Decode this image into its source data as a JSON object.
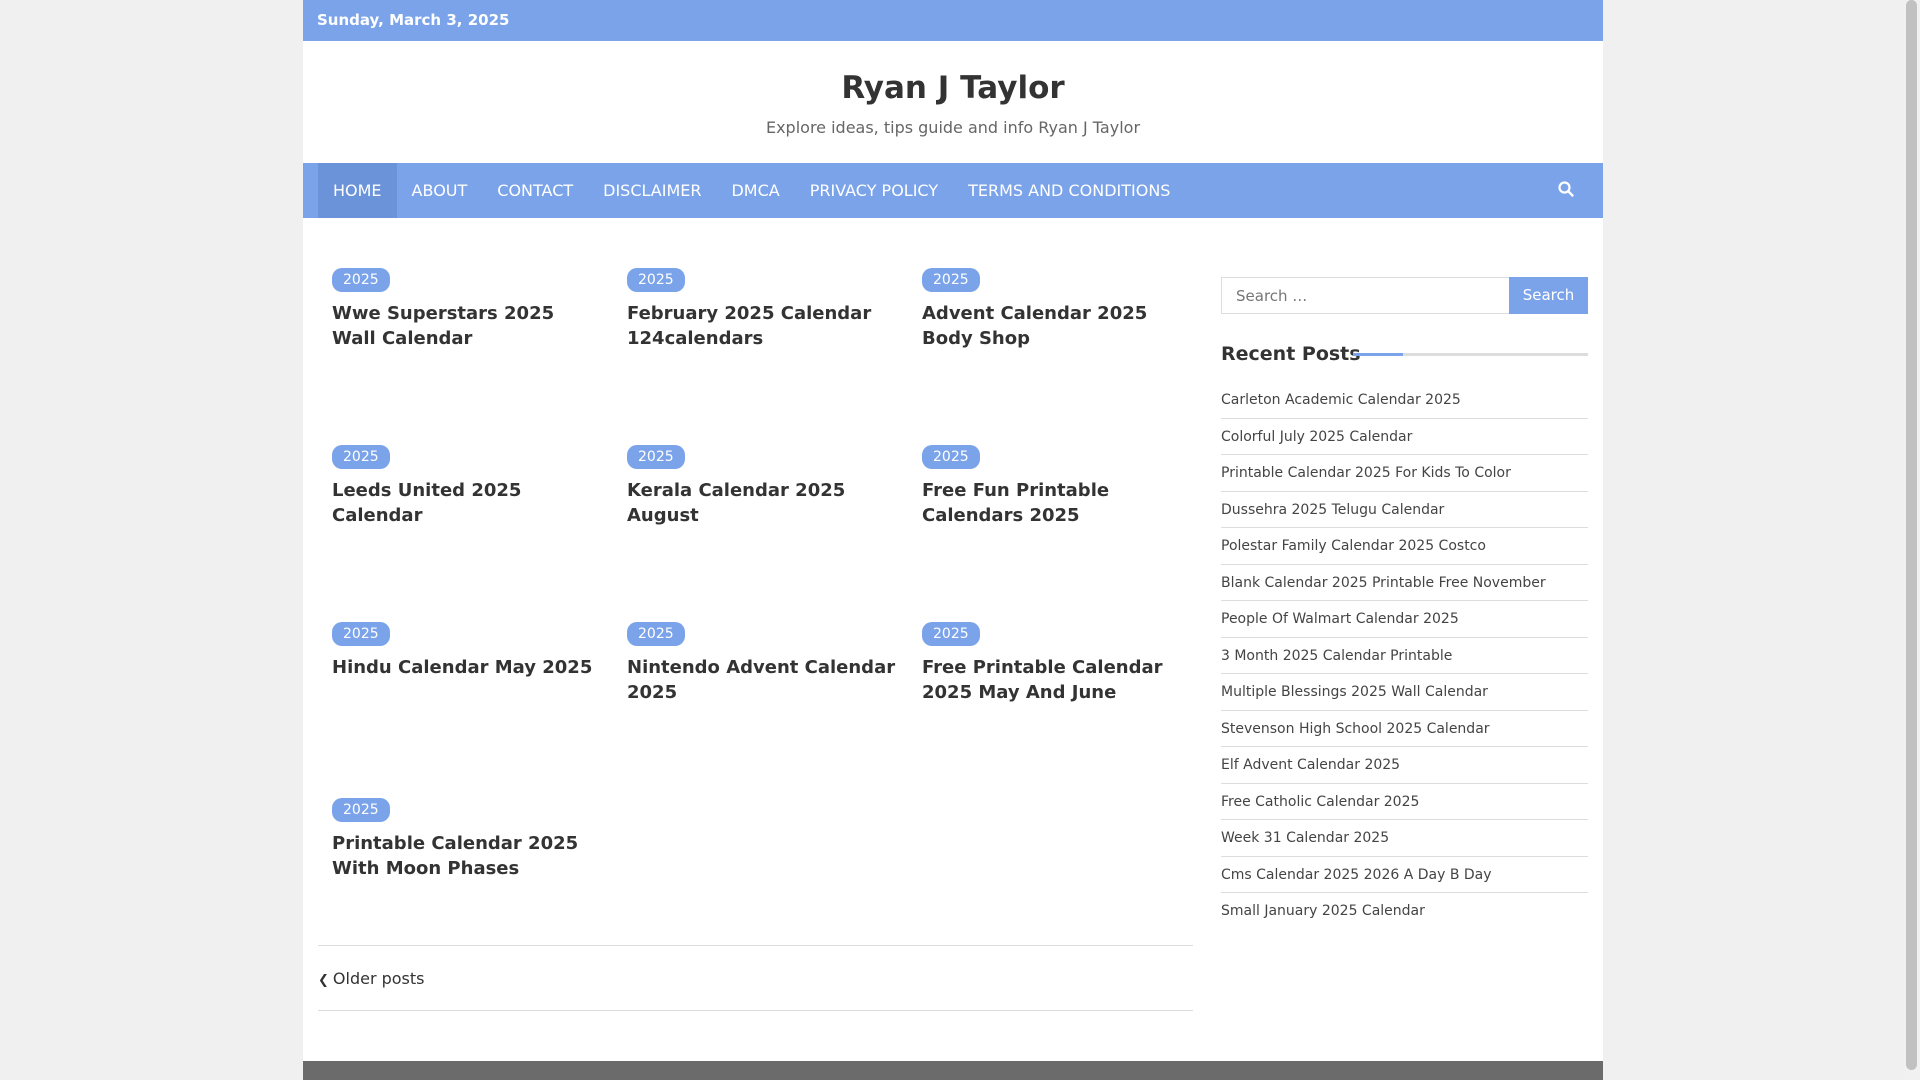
{
  "topbar": {
    "date": "Sunday, March 3, 2025"
  },
  "site": {
    "title": "Ryan J Taylor",
    "description": "Explore ideas, tips guide and info Ryan J Taylor"
  },
  "nav": {
    "items": [
      {
        "label": "HOME"
      },
      {
        "label": "ABOUT"
      },
      {
        "label": "CONTACT"
      },
      {
        "label": "DISCLAIMER"
      },
      {
        "label": "DMCA"
      },
      {
        "label": "PRIVACY POLICY"
      },
      {
        "label": "TERMS AND CONDITIONS"
      }
    ],
    "search_icon": "search-icon"
  },
  "posts": [
    {
      "category": "2025",
      "title": "Wwe Superstars 2025 Wall Calendar"
    },
    {
      "category": "2025",
      "title": "February 2025 Calendar 124calendars"
    },
    {
      "category": "2025",
      "title": "Advent Calendar 2025 Body Shop"
    },
    {
      "category": "2025",
      "title": "Leeds United 2025 Calendar"
    },
    {
      "category": "2025",
      "title": "Kerala Calendar 2025 August"
    },
    {
      "category": "2025",
      "title": "Free Fun Printable Calendars 2025"
    },
    {
      "category": "2025",
      "title": "Hindu Calendar May 2025"
    },
    {
      "category": "2025",
      "title": "Nintendo Advent Calendar 2025"
    },
    {
      "category": "2025",
      "title": "Free Printable Calendar 2025 May And June"
    },
    {
      "category": "2025",
      "title": "Printable Calendar 2025 With Moon Phases"
    }
  ],
  "pagination": {
    "older_label": "Older posts"
  },
  "sidebar": {
    "search_placeholder": "Search …",
    "search_button": "Search",
    "recent_heading": "Recent Posts",
    "recent_posts": [
      "Carleton Academic Calendar 2025",
      "Colorful July 2025 Calendar",
      "Printable Calendar 2025 For Kids To Color",
      "Dussehra 2025 Telugu Calendar",
      "Polestar Family Calendar 2025 Costco",
      "Blank Calendar 2025 Printable Free November",
      "People Of Walmart Calendar 2025",
      "3 Month 2025 Calendar Printable",
      "Multiple Blessings 2025 Wall Calendar",
      "Stevenson High School 2025 Calendar",
      "Elf Advent Calendar 2025",
      "Free Catholic Calendar 2025",
      "Week 31 Calendar 2025",
      "Cms Calendar 2025 2026 A Day B Day",
      "Small January 2025 Calendar"
    ]
  },
  "colors": {
    "accent": "#7ba3ea",
    "accent_dark": "#6b93da"
  }
}
